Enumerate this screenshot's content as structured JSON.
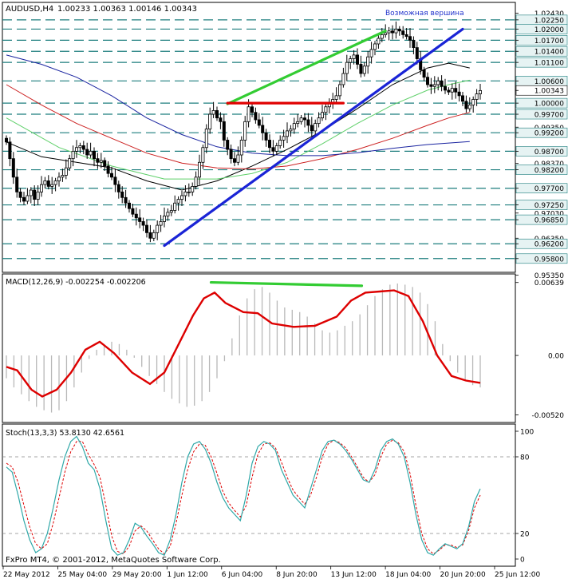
{
  "header": {
    "symbol": "AUDUSD,H4",
    "ohlc": "1.00233 1.00363 1.00146 1.00343",
    "annotation": "Возможная вершина"
  },
  "footer": "FxPro MT4, © 2001-2012, MetaQuotes Software Corp.",
  "colors": {
    "background": "#ffffff",
    "grid": "#1c7d7d",
    "candles": "#000000",
    "support_lines": "#1c7d7d",
    "trendline": "#1a24d6",
    "green_line": "#33cc33",
    "red_line": "#e00000",
    "ma_black": "#000000",
    "ma_red": "#cc2020",
    "ma_green": "#5fd06a",
    "ma_blue": "#1a24a0",
    "macd_signal": "#dd0000",
    "macd_hist": "#b8b8b8",
    "stoch_main": "#2fa8a8",
    "stoch_signal": "#dd0000"
  },
  "chart_data": [
    {
      "type": "candlestick",
      "title": "AUDUSD,H4",
      "ylim": [
        0.9545,
        1.027
      ],
      "price_labels": [
        "1.02430",
        "1.02250",
        "1.02000",
        "1.01700",
        "1.01400",
        "1.01100",
        "1.00600",
        "1.00343",
        "1.00000",
        "0.99700",
        "0.99350",
        "0.99200",
        "0.98700",
        "0.98370",
        "0.98200",
        "0.97700",
        "0.97250",
        "0.97030",
        "0.96850",
        "0.96350",
        "0.96200",
        "0.95800",
        "0.95350"
      ],
      "horizontal_levels": [
        1.0225,
        1.02,
        1.017,
        1.014,
        1.011,
        1.006,
        1.0,
        0.997,
        0.992,
        0.987,
        0.982,
        0.977,
        0.9725,
        0.9685,
        0.962,
        0.958
      ],
      "current_price": 1.00343,
      "x_labels": [
        "22 May 2012",
        "25 May 04:00",
        "29 May 20:00",
        "1 Jun 12:00",
        "6 Jun 04:00",
        "8 Jun 20:00",
        "13 Jun 12:00",
        "18 Jun 04:00",
        "20 Jun 20:00",
        "25 Jun 12:00"
      ],
      "closes": [
        0.9895,
        0.985,
        0.98,
        0.976,
        0.9745,
        0.9735,
        0.975,
        0.9765,
        0.974,
        0.976,
        0.978,
        0.979,
        0.9775,
        0.978,
        0.979,
        0.98,
        0.9805,
        0.9825,
        0.985,
        0.987,
        0.988,
        0.9885,
        0.9875,
        0.986,
        0.987,
        0.985,
        0.984,
        0.9845,
        0.983,
        0.981,
        0.98,
        0.978,
        0.976,
        0.9745,
        0.973,
        0.9715,
        0.97,
        0.969,
        0.968,
        0.967,
        0.965,
        0.9635,
        0.965,
        0.967,
        0.968,
        0.9695,
        0.9705,
        0.971,
        0.973,
        0.974,
        0.975,
        0.976,
        0.976,
        0.9775,
        0.98,
        0.984,
        0.988,
        0.993,
        0.997,
        0.998,
        0.996,
        0.995,
        0.99,
        0.9875,
        0.985,
        0.984,
        0.986,
        0.99,
        0.995,
        0.999,
        0.9975,
        0.9955,
        0.994,
        0.992,
        0.99,
        0.988,
        0.987,
        0.9885,
        0.99,
        0.991,
        0.9925,
        0.993,
        0.9945,
        0.995,
        0.996,
        0.9955,
        0.994,
        0.9925,
        0.9945,
        0.996,
        0.9975,
        0.999,
        1.0,
        1.001,
        1.002,
        1.005,
        1.008,
        1.011,
        1.012,
        1.013,
        1.0105,
        1.008,
        1.01,
        1.0125,
        1.0145,
        1.016,
        1.0175,
        1.0185,
        1.019,
        1.0195,
        1.019,
        1.02,
        1.0195,
        1.0185,
        1.018,
        1.017,
        1.015,
        1.012,
        1.009,
        1.007,
        1.005,
        1.0045,
        1.005,
        1.006,
        1.0045,
        1.0035,
        1.003,
        1.004,
        1.003,
        1.002,
        1.0005,
        0.9985,
        0.9995,
        1.001,
        1.0025,
        1.0034
      ],
      "annotations": {
        "possible_top_label": "Возможная вершина"
      },
      "moving_averages": [
        {
          "color": "#000000",
          "points": [
            [
              0,
              0.9895
            ],
            [
              10,
              0.9855
            ],
            [
              20,
              0.984
            ],
            [
              30,
              0.9825
            ],
            [
              40,
              0.979
            ],
            [
              50,
              0.9765
            ],
            [
              60,
              0.979
            ],
            [
              70,
              0.983
            ],
            [
              80,
              0.9875
            ],
            [
              90,
              0.9925
            ],
            [
              100,
              0.9985
            ],
            [
              110,
              1.005
            ],
            [
              120,
              1.0095
            ],
            [
              126,
              1.0108
            ],
            [
              132,
              1.0095
            ]
          ]
        },
        {
          "color": "#5fd06a",
          "points": [
            [
              0,
              0.996
            ],
            [
              15,
              0.988
            ],
            [
              30,
              0.983
            ],
            [
              45,
              0.9795
            ],
            [
              60,
              0.9795
            ],
            [
              70,
              0.981
            ],
            [
              80,
              0.984
            ],
            [
              90,
              0.989
            ],
            [
              100,
              0.9945
            ],
            [
              110,
              0.9995
            ],
            [
              120,
              1.0035
            ],
            [
              126,
              1.005
            ],
            [
              132,
              1.0062
            ]
          ]
        },
        {
          "color": "#cc2020",
          "points": [
            [
              0,
              1.005
            ],
            [
              10,
              0.9995
            ],
            [
              20,
              0.9945
            ],
            [
              30,
              0.9905
            ],
            [
              40,
              0.9865
            ],
            [
              50,
              0.9838
            ],
            [
              60,
              0.9825
            ],
            [
              70,
              0.9822
            ],
            [
              80,
              0.983
            ],
            [
              90,
              0.985
            ],
            [
              100,
              0.9875
            ],
            [
              110,
              0.9905
            ],
            [
              120,
              0.994
            ],
            [
              126,
              0.996
            ],
            [
              132,
              0.9975
            ]
          ]
        },
        {
          "color": "#1a24a0",
          "points": [
            [
              0,
              1.013
            ],
            [
              10,
              1.0105
            ],
            [
              20,
              1.007
            ],
            [
              30,
              1.002
            ],
            [
              40,
              0.996
            ],
            [
              50,
              0.9915
            ],
            [
              60,
              0.9882
            ],
            [
              70,
              0.9865
            ],
            [
              80,
              0.9858
            ],
            [
              90,
              0.9858
            ],
            [
              100,
              0.9866
            ],
            [
              110,
              0.9878
            ],
            [
              120,
              0.9888
            ],
            [
              132,
              0.9896
            ]
          ]
        }
      ],
      "drawn_lines": [
        {
          "name": "blue-trendline",
          "color": "#1a24d6",
          "points": [
            [
              45,
              0.9615
            ],
            [
              130,
              1.02
            ]
          ]
        },
        {
          "name": "green-line",
          "color": "#33cc33",
          "points": [
            [
              63,
              0.9998
            ],
            [
              108,
              1.0195
            ]
          ]
        },
        {
          "name": "red-line",
          "color": "#e00000",
          "points": [
            [
              63,
              1.0
            ],
            [
              96,
              1.0
            ]
          ]
        }
      ]
    },
    {
      "type": "line",
      "title": "MACD(12,26,9) -0.002254 -0.002206",
      "ylim": [
        -0.0058,
        0.007
      ],
      "tick_labels": [
        "0.00639",
        "0.00",
        "-0.00520"
      ],
      "macd_hist": [
        -0.002,
        -0.0028,
        -0.0034,
        -0.004,
        -0.0045,
        -0.0048,
        -0.005,
        -0.0048,
        -0.004,
        -0.0028,
        -0.0015,
        -0.0003,
        0.0005,
        0.001,
        0.0012,
        0.001,
        0.0005,
        -0.0002,
        -0.001,
        -0.0018,
        -0.0025,
        -0.0032,
        -0.0038,
        -0.0042,
        -0.0045,
        -0.0044,
        -0.004,
        -0.0032,
        -0.002,
        -0.0005,
        0.0015,
        0.0035,
        0.005,
        0.0058,
        0.006,
        0.0055,
        0.0048,
        0.0042,
        0.004,
        0.0038,
        0.0034,
        0.0028,
        0.0022,
        0.002,
        0.0022,
        0.0026,
        0.003,
        0.0036,
        0.0044,
        0.0052,
        0.0058,
        0.0062,
        0.0063,
        0.0062,
        0.006,
        0.0055,
        0.0045,
        0.003,
        0.001,
        -0.0005,
        -0.0015,
        -0.0022,
        -0.0026,
        -0.0028
      ],
      "macd_signal_points": [
        [
          0,
          -0.001
        ],
        [
          3,
          -0.0013
        ],
        [
          7,
          -0.003
        ],
        [
          10,
          -0.0036
        ],
        [
          14,
          -0.003
        ],
        [
          18,
          -0.0015
        ],
        [
          22,
          0.0005
        ],
        [
          26,
          0.0012
        ],
        [
          30,
          0.0002
        ],
        [
          35,
          -0.0015
        ],
        [
          40,
          -0.0025
        ],
        [
          44,
          -0.0015
        ],
        [
          48,
          0.001
        ],
        [
          52,
          0.0035
        ],
        [
          55,
          0.005
        ],
        [
          58,
          0.0055
        ],
        [
          61,
          0.0046
        ],
        [
          66,
          0.0038
        ],
        [
          70,
          0.0037
        ],
        [
          74,
          0.0028
        ],
        [
          80,
          0.0025
        ],
        [
          86,
          0.0026
        ],
        [
          92,
          0.0034
        ],
        [
          96,
          0.0048
        ],
        [
          100,
          0.0055
        ],
        [
          104,
          0.0056
        ],
        [
          108,
          0.0057
        ],
        [
          112,
          0.0052
        ],
        [
          116,
          0.003
        ],
        [
          120,
          0.0
        ],
        [
          124,
          -0.0018
        ],
        [
          128,
          -0.0022
        ],
        [
          132,
          -0.0024
        ]
      ],
      "divergence_line": {
        "color": "#33cc33",
        "points": [
          [
            57,
            0.0064
          ],
          [
            99,
            0.0061
          ]
        ]
      }
    },
    {
      "type": "line",
      "title": "Stoch(13,3,3) 53.8130 42.6561",
      "ylim": [
        0,
        100
      ],
      "tick_labels": [
        "100",
        "80",
        "20",
        "0"
      ],
      "stoch_main": [
        72,
        68,
        50,
        30,
        15,
        5,
        8,
        20,
        40,
        62,
        80,
        92,
        96,
        88,
        75,
        70,
        55,
        30,
        8,
        3,
        5,
        15,
        28,
        25,
        18,
        12,
        5,
        3,
        15,
        35,
        60,
        80,
        90,
        92,
        86,
        75,
        60,
        48,
        40,
        35,
        30,
        50,
        75,
        88,
        92,
        90,
        85,
        70,
        60,
        50,
        45,
        40,
        55,
        70,
        85,
        92,
        93,
        90,
        85,
        78,
        70,
        62,
        60,
        70,
        85,
        92,
        94,
        90,
        80,
        60,
        35,
        15,
        5,
        3,
        8,
        12,
        10,
        8,
        12,
        25,
        45,
        55
      ],
      "stoch_signal": [
        75,
        72,
        60,
        42,
        25,
        12,
        8,
        12,
        28,
        48,
        68,
        84,
        92,
        92,
        82,
        74,
        64,
        42,
        18,
        6,
        4,
        10,
        22,
        26,
        22,
        15,
        8,
        4,
        10,
        28,
        50,
        70,
        84,
        90,
        89,
        80,
        67,
        53,
        44,
        38,
        33,
        42,
        64,
        82,
        90,
        91,
        87,
        76,
        64,
        54,
        48,
        43,
        50,
        64,
        80,
        90,
        93,
        91,
        87,
        80,
        72,
        64,
        60,
        66,
        80,
        90,
        93,
        91,
        84,
        67,
        42,
        20,
        8,
        4,
        7,
        11,
        11,
        9,
        11,
        22,
        40,
        50
      ]
    }
  ]
}
